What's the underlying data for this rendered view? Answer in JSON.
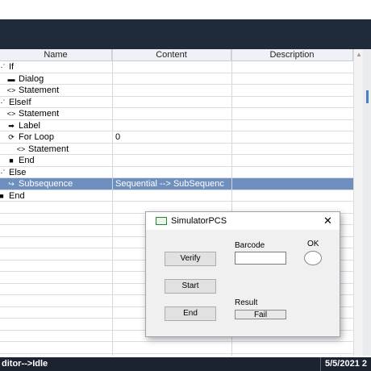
{
  "grid": {
    "columns": [
      "Name",
      "Content",
      "Description"
    ],
    "rows": [
      {
        "indent": 0,
        "icon": "if-icon",
        "glyph": "⋰",
        "name": "If",
        "content": "",
        "selected": false
      },
      {
        "indent": 1,
        "icon": "dialog-icon",
        "glyph": "▬",
        "name": "Dialog",
        "content": "",
        "selected": false
      },
      {
        "indent": 1,
        "icon": "statement-icon",
        "glyph": "<>",
        "name": "Statement",
        "content": "",
        "selected": false
      },
      {
        "indent": 0,
        "icon": "elseif-icon",
        "glyph": "⋰",
        "name": "ElseIf",
        "content": "",
        "selected": false
      },
      {
        "indent": 1,
        "icon": "statement-icon",
        "glyph": "<>",
        "name": "Statement",
        "content": "",
        "selected": false
      },
      {
        "indent": 1,
        "icon": "label-icon",
        "glyph": "➡",
        "name": "Label",
        "content": "",
        "selected": false
      },
      {
        "indent": 1,
        "icon": "for-loop-icon",
        "glyph": "⟳",
        "name": "For Loop",
        "content": "0",
        "selected": false
      },
      {
        "indent": 2,
        "icon": "statement-icon",
        "glyph": "<>",
        "name": "Statement",
        "content": "",
        "selected": false
      },
      {
        "indent": 1,
        "icon": "end-icon",
        "glyph": "■",
        "name": "End",
        "content": "",
        "selected": false
      },
      {
        "indent": 0,
        "icon": "else-icon",
        "glyph": "⋰",
        "name": "Else",
        "content": "",
        "selected": false
      },
      {
        "indent": 1,
        "icon": "subsequence-icon",
        "glyph": "↪",
        "name": "Subsequence",
        "content": "Sequential --> SubSequenc",
        "selected": true
      },
      {
        "indent": 0,
        "icon": "end-icon",
        "glyph": "■",
        "name": "End",
        "content": "",
        "selected": false
      }
    ]
  },
  "dialog": {
    "title": "SimulatorPCS",
    "close": "✕",
    "verify": "Verify",
    "start": "Start",
    "end": "End",
    "barcode_label": "Barcode",
    "barcode_value": "",
    "ok_label": "OK",
    "result_label": "Result",
    "result_value": "Fail"
  },
  "status": {
    "left": "ditor-->Idle",
    "right": "5/5/2021 2"
  },
  "colors": {
    "selection": "#6f8fbf",
    "titlebar": "#1f2a3a",
    "statusbar": "#1b2331"
  }
}
